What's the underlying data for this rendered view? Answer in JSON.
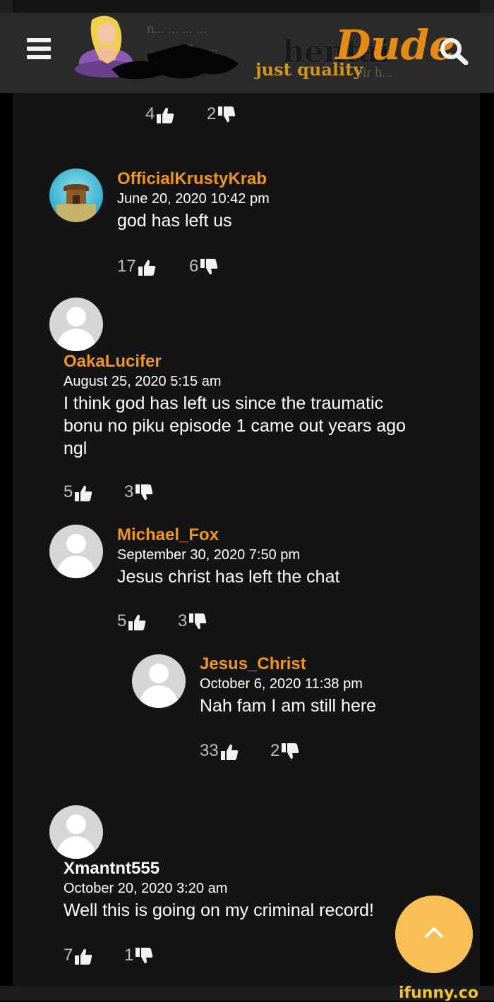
{
  "header": {
    "logo_hentai": "hentai",
    "logo_dude": "Dude",
    "logo_tagline": "just quality",
    "bleed_text_1": "n... ... ... ...",
    "bleed_text_2": "...e... ...",
    "bleed_text_3": "eir h..."
  },
  "top_votes": {
    "likes": "4",
    "dislikes": "2"
  },
  "comments": [
    {
      "username": "OfficialKrustyKrab",
      "date": "June 20, 2020 10:42 pm",
      "text": "god has left us",
      "likes": "17",
      "dislikes": "6"
    },
    {
      "username": "OakaLucifer",
      "date": "August 25, 2020 5:15 am",
      "text_lines": [
        "I think god has left us since the traumatic",
        "bonu no piku episode 1 came out years ago",
        "ngl"
      ],
      "likes": "5",
      "dislikes": "3"
    },
    {
      "username": "Michael_Fox",
      "date": "September 30, 2020 7:50 pm",
      "text": "Jesus christ has left the chat",
      "likes": "5",
      "dislikes": "3"
    },
    {
      "username": "Jesus_Christ",
      "date": "October 6, 2020 11:38 pm",
      "text": "Nah fam I am still here",
      "likes": "33",
      "dislikes": "2"
    },
    {
      "username": "Xmantnt555",
      "date": "October 20, 2020 3:20 am",
      "text": "Well this is going on my criminal record!",
      "likes": "7",
      "dislikes": "1"
    }
  ],
  "icons": {
    "menu": "hamburger-icon",
    "search": "search-icon",
    "like": "thumbs-up-icon",
    "dislike": "thumbs-down-icon",
    "scroll_top": "chevron-up-icon"
  },
  "colors": {
    "username": "#f0951d",
    "accent_button": "#f7bf54",
    "background": "#141414",
    "header": "#2a2a2a"
  },
  "watermark": "ifunny.co"
}
